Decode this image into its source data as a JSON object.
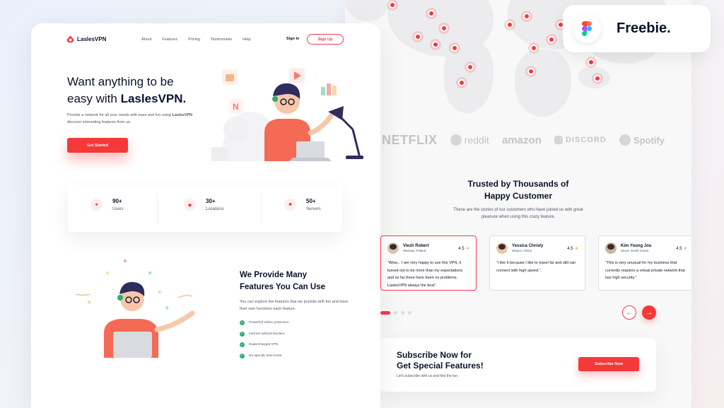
{
  "badge": {
    "label": "Freebie.",
    "icon": "figma-icon"
  },
  "nav": {
    "logo": "LaslesVPN",
    "links": [
      "About",
      "Features",
      "Pricing",
      "Testimonials",
      "Help"
    ],
    "sign_in": "Sign In",
    "sign_up": "Sign Up"
  },
  "hero": {
    "title_line1": "Want anything to be",
    "title_line2_prefix": "easy with ",
    "title_line2_bold": "LaslesVPN.",
    "text_prefix": "Provide a network for all your needs with ease and fun using ",
    "text_bold": "LaslesVPN",
    "text_suffix": " discover interesting features from us.",
    "cta": "Get Started"
  },
  "stats": [
    {
      "value": "90+",
      "label": "Users",
      "icon": "user-icon"
    },
    {
      "value": "30+",
      "label": "Locations",
      "icon": "location-icon"
    },
    {
      "value": "50+",
      "label": "Servers",
      "icon": "server-icon"
    }
  ],
  "features": {
    "title_line1": "We Provide Many",
    "title_line2": "Features You Can Use",
    "text": "You can explore the features that we provide with fun and have their own functions each feature.",
    "items": [
      "Powerfull online protection.",
      "Internet without borders.",
      "Supercharged VPN",
      "No specific time limits."
    ]
  },
  "brands": [
    "NETFLIX",
    "reddit",
    "amazon",
    "DISCORD",
    "Spotify"
  ],
  "trusted": {
    "title_line1": "Trusted by Thousands of",
    "title_line2": "Happy Customer",
    "text": "These are the stories of our customers who have joined us with great pleasure when using this crazy feature."
  },
  "testimonials": [
    {
      "name": "Viezh Robert",
      "location": "Warsaw, Poland",
      "rating": "4.5",
      "text": "“Wow... I am very happy to use this VPN, it turned out to be more than my expectations and so far there have been no problems. LaslesVPN always the best”."
    },
    {
      "name": "Yessica Christy",
      "location": "Shanxi, China",
      "rating": "4.5",
      "text": "“I like it because I like to travel far and still can connect with high speed.”."
    },
    {
      "name": "Kim Young Jou",
      "location": "Seoul, South Korea",
      "rating": "4.5",
      "text": "“This is very unusual for my business that currently requires a virtual private network that has high security.”."
    }
  ],
  "carousel": {
    "prev": "←",
    "next": "→"
  },
  "subscribe": {
    "title_line1": "Subscribe Now for",
    "title_line2": "Get Special Features!",
    "text": "Let's subscribe with us and find the fun.",
    "button": "Subscribe Now"
  },
  "colors": {
    "accent": "#F53838",
    "dark": "#0B132A",
    "muted": "#4F5665",
    "success": "#2FAB73"
  }
}
